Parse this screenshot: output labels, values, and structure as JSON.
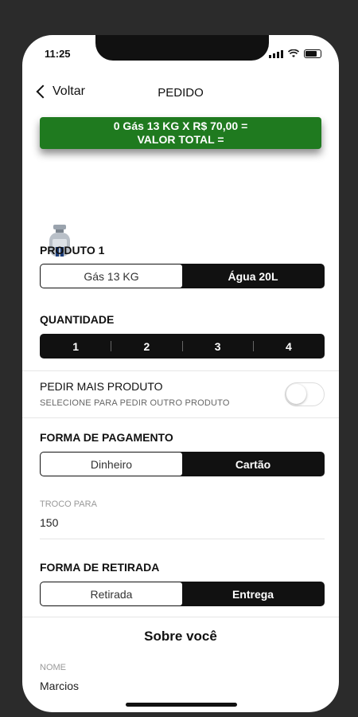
{
  "status": {
    "time": "11:25"
  },
  "nav": {
    "back_label": "Voltar",
    "title": "PEDIDO"
  },
  "summary": {
    "line1": "0 Gás 13 KG X R$ 70,00 =",
    "line2": "VALOR TOTAL ="
  },
  "product": {
    "label": "PRODUTO 1",
    "options": [
      "Gás 13 KG",
      "Água 20L"
    ],
    "selected": "Gás 13 KG"
  },
  "quantity": {
    "label": "QUANTIDADE",
    "options": [
      "1",
      "2",
      "3",
      "4"
    ]
  },
  "more_product": {
    "title": "PEDIR MAIS PRODUTO",
    "subtitle": "SELECIONE PARA PEDIR OUTRO PRODUTO",
    "enabled": false
  },
  "payment": {
    "label": "FORMA DE PAGAMENTO",
    "options": [
      "Dinheiro",
      "Cartão"
    ],
    "selected": "Dinheiro",
    "change_label": "TROCO PARA",
    "change_value": "150"
  },
  "pickup": {
    "label": "FORMA DE RETIRADA",
    "options": [
      "Retirada",
      "Entrega"
    ],
    "selected": "Retirada"
  },
  "about": {
    "title": "Sobre você",
    "name_label": "NOME",
    "name_value": "Marcios"
  },
  "colors": {
    "accent_green": "#1f7a1f",
    "segment_dark": "#111111"
  }
}
